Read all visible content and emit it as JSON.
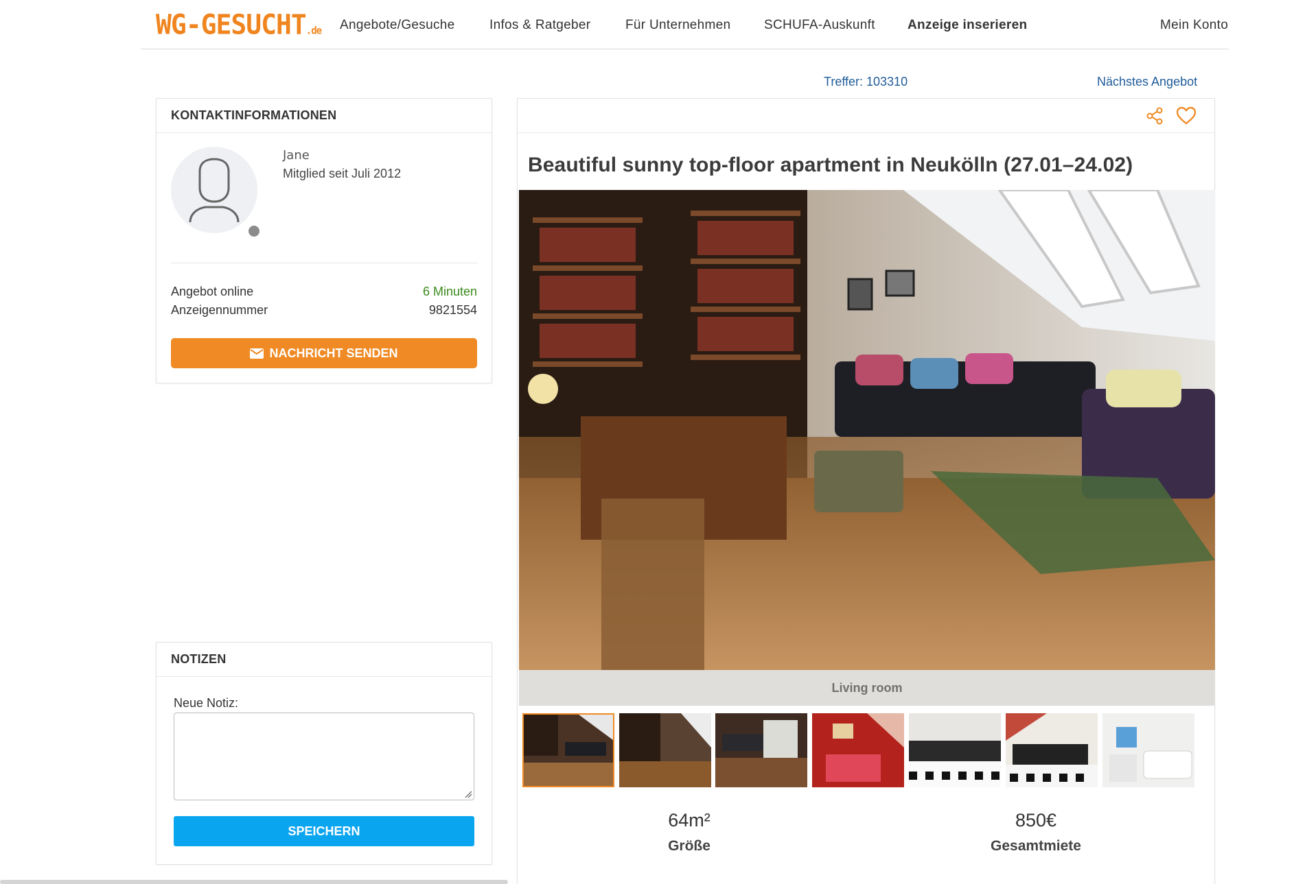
{
  "header": {
    "logo_main": "WG-GESUCHT",
    "logo_suffix": ".de",
    "nav": [
      "Angebote/Gesuche",
      "Infos & Ratgeber",
      "Für Unternehmen",
      "SCHUFA-Auskunft",
      "Anzeige inserieren"
    ],
    "account": "Mein Konto"
  },
  "top_links": {
    "hits": "Treffer: 103310",
    "next": "Nächstes Angebot"
  },
  "contact": {
    "heading": "KONTAKTINFORMATIONEN",
    "name": "Jane",
    "member_since": "Mitglied seit Juli 2012",
    "online_label": "Angebot online",
    "online_value": "6 Minuten",
    "ad_number_label": "Anzeigennummer",
    "ad_number_value": "9821554",
    "send_button": "NACHRICHT SENDEN"
  },
  "notes": {
    "heading": "NOTIZEN",
    "label": "Neue Notiz:",
    "value": "",
    "save_button": "SPEICHERN"
  },
  "listing": {
    "title": "Beautiful sunny top-floor apartment in Neukölln (27.01–24.02)",
    "photo_caption": "Living room",
    "thumbnail_count": 7,
    "active_thumbnail": 1,
    "size_value": "64m²",
    "size_label": "Größe",
    "rent_value": "850€",
    "rent_label": "Gesamtmiete"
  },
  "colors": {
    "brand_orange": "#f08a24",
    "button_blue": "#0aa5ef",
    "link_blue": "#1f5c99",
    "online_green": "#3a8a1c"
  },
  "icons": {
    "share": "share-icon",
    "favorite": "heart-icon",
    "message": "mail-icon",
    "avatar": "user-silhouette-icon"
  }
}
